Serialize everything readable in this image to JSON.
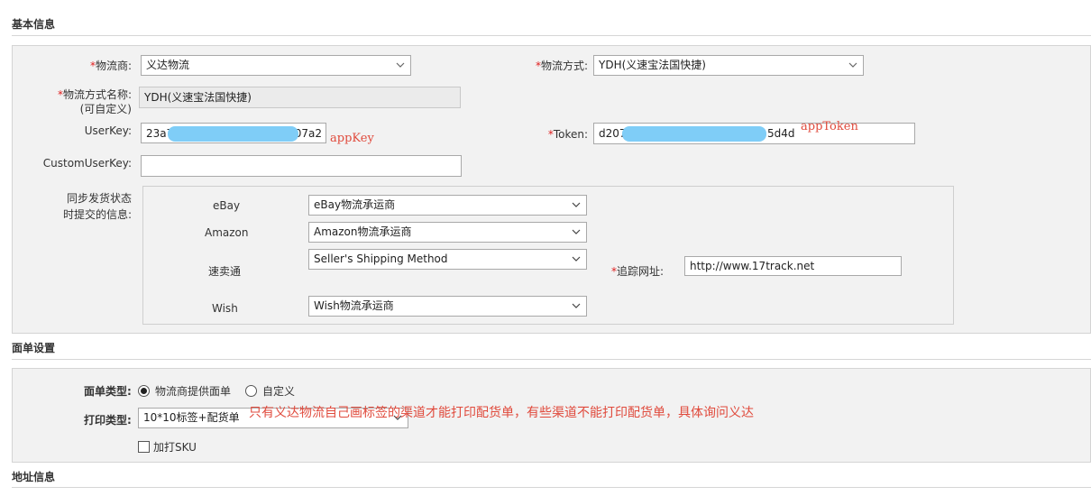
{
  "sections": {
    "basic": "基本信息",
    "label_settings": "面单设置",
    "address": "地址信息"
  },
  "basic": {
    "carrier": {
      "required_mark": "*",
      "label": "物流商:",
      "value": "义达物流"
    },
    "method": {
      "required_mark": "*",
      "label": "物流方式:",
      "value": "YDH(义速宝法国快捷)"
    },
    "method_name": {
      "required_mark": "*",
      "label_line1": "物流方式名称:",
      "label_line2": "(可自定义)",
      "value": "YDH(义速宝法国快捷)"
    },
    "userkey": {
      "label": "UserKey:",
      "value_start": "23a7",
      "value_end": "07a2",
      "note": "appKey"
    },
    "token": {
      "required_mark": "*",
      "label": "Token:",
      "value_start": "d207",
      "value_end": "5d4d",
      "note": "appToken"
    },
    "custom_userkey": {
      "label": "CustomUserKey:",
      "value": ""
    },
    "sync": {
      "label_line1": "同步发货状态",
      "label_line2": "时提交的信息:",
      "rows": [
        {
          "platform": "eBay",
          "value": "eBay物流承运商"
        },
        {
          "platform": "Amazon",
          "value": "Amazon物流承运商"
        },
        {
          "platform": "速卖通",
          "value": "Seller's Shipping Method"
        },
        {
          "platform": "Wish",
          "value": "Wish物流承运商"
        }
      ],
      "tracking": {
        "required_mark": "*",
        "label": "追踪网址:",
        "value": "http://www.17track.net"
      }
    }
  },
  "label_settings": {
    "type": {
      "label": "面单类型:",
      "option1": "物流商提供面单",
      "option2": "自定义",
      "selected": "物流商提供面单"
    },
    "print": {
      "label": "打印类型:",
      "value": "10*10标签+配货单"
    },
    "note": "只有义达物流自己画标签的渠道才能打印配货单，有些渠道不能打印配货单，具体询问义达",
    "sku": {
      "label": "加打SKU",
      "checked": false
    }
  },
  "colors": {
    "required": "#e02020",
    "annotation": "#e04a3c",
    "redaction": "#7fcdf7",
    "panel": "#f2f2f2"
  },
  "icons": {
    "select_caret": "chevron-down-icon"
  }
}
